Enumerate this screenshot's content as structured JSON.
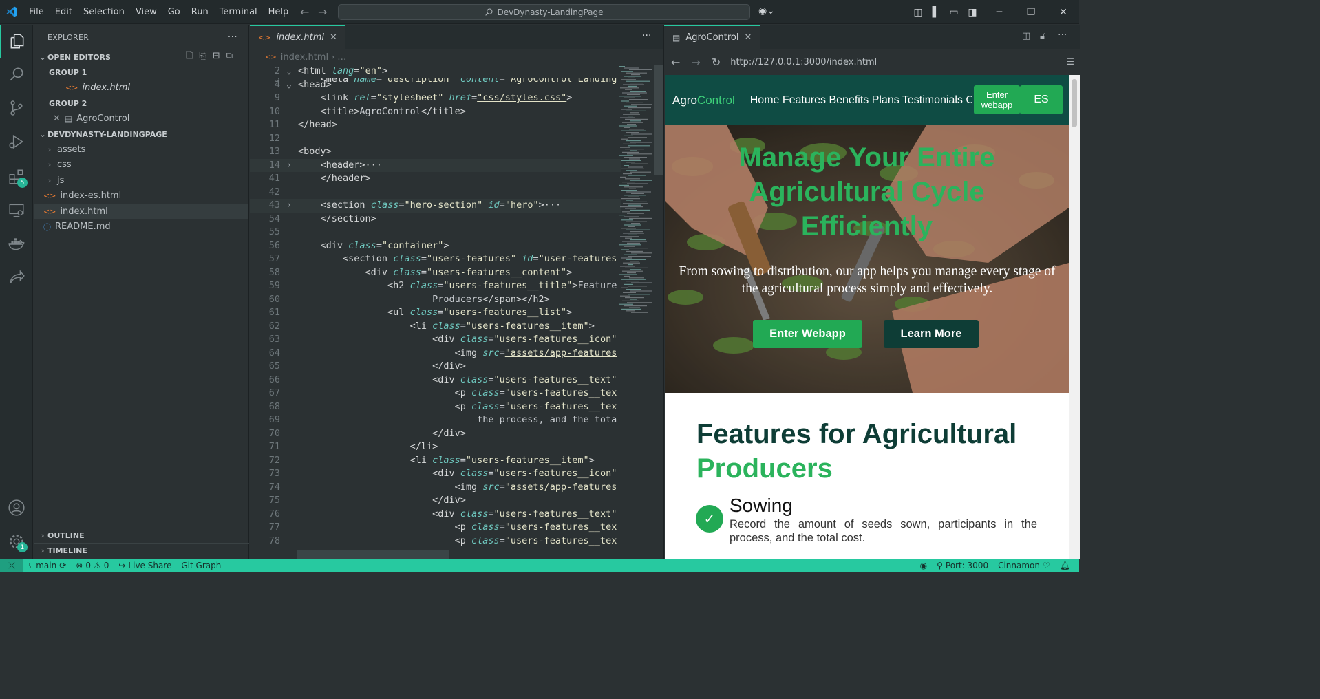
{
  "titlebar": {
    "menu": [
      "File",
      "Edit",
      "Selection",
      "View",
      "Go",
      "Run",
      "Terminal",
      "Help"
    ],
    "command_center": "DevDynasty-LandingPage"
  },
  "activity": {
    "extensions_badge": "5",
    "manage_badge": "1"
  },
  "sidebar": {
    "title": "EXPLORER",
    "open_editors_label": "OPEN EDITORS",
    "group1_label": "GROUP 1",
    "group1_file": "index.html",
    "group2_label": "GROUP 2",
    "group2_file": "AgroControl",
    "project_label": "DEVDYNASTY-LANDINGPAGE",
    "folders": [
      "assets",
      "css",
      "js"
    ],
    "files": [
      "index-es.html",
      "index.html",
      "README.md"
    ],
    "outline_label": "OUTLINE",
    "timeline_label": "TIMELINE"
  },
  "editor": {
    "tab_label": "index.html",
    "breadcrumb": "index.html",
    "breadcrumb_more": "…",
    "lines": [
      {
        "n": "2",
        "fold": "⌄",
        "html": "<span class=\"tg\">&lt;html</span> <span class=\"at\">lang</span><span class=\"pl\">=</span><span class=\"st\">\"en\"</span><span class=\"tg\">&gt;</span>"
      },
      {
        "n": "4",
        "fold": "⌄",
        "html": "<span class=\"tg\">&lt;head&gt;</span>"
      },
      {
        "n": "9",
        "fold": "",
        "html": "    <span class=\"tg\">&lt;link</span> <span class=\"at\">rel</span>=<span class=\"st\">\"stylesheet\"</span> <span class=\"at\">href</span>=<span class=\"st ul\">\"css/styles.css\"</span><span class=\"tg\">&gt;</span>"
      },
      {
        "n": "10",
        "fold": "",
        "html": "    <span class=\"tg\">&lt;title&gt;</span>AgroControl<span class=\"tg\">&lt;/title&gt;</span>"
      },
      {
        "n": "11",
        "fold": "",
        "html": "<span class=\"tg\">&lt;/head&gt;</span>"
      },
      {
        "n": "12",
        "fold": "",
        "html": ""
      },
      {
        "n": "13",
        "fold": "",
        "html": "<span class=\"tg\">&lt;body&gt;</span>"
      },
      {
        "n": "14",
        "fold": "›",
        "html": "    <span class=\"tg\">&lt;header&gt;</span><span class=\"pl\">···</span>"
      },
      {
        "n": "41",
        "fold": "",
        "html": "    <span class=\"tg\">&lt;/header&gt;</span>"
      },
      {
        "n": "42",
        "fold": "",
        "html": ""
      },
      {
        "n": "43",
        "fold": "›",
        "html": "    <span class=\"tg\">&lt;section</span> <span class=\"at\">class</span>=<span class=\"st\">\"hero-section\"</span> <span class=\"at\">id</span>=<span class=\"st\">\"hero\"</span><span class=\"tg\">&gt;</span><span class=\"pl\">···</span>"
      },
      {
        "n": "54",
        "fold": "",
        "html": "    <span class=\"tg\">&lt;/section&gt;</span>"
      },
      {
        "n": "55",
        "fold": "",
        "html": ""
      },
      {
        "n": "56",
        "fold": "",
        "html": "    <span class=\"tg\">&lt;div</span> <span class=\"at\">class</span>=<span class=\"st\">\"container\"</span><span class=\"tg\">&gt;</span>"
      },
      {
        "n": "57",
        "fold": "",
        "html": "        <span class=\"tg\">&lt;section</span> <span class=\"at\">class</span>=<span class=\"st\">\"users-features\"</span> <span class=\"at\">id</span>=<span class=\"st\">\"user-features</span>"
      },
      {
        "n": "58",
        "fold": "",
        "html": "            <span class=\"tg\">&lt;div</span> <span class=\"at\">class</span>=<span class=\"st\">\"users-features__content\"</span><span class=\"tg\">&gt;</span>"
      },
      {
        "n": "59",
        "fold": "",
        "html": "                <span class=\"tg\">&lt;h2</span> <span class=\"at\">class</span>=<span class=\"st\">\"users-features__title\"</span><span class=\"tg\">&gt;</span>Feature"
      },
      {
        "n": "60",
        "fold": "",
        "html": "                        Producers<span class=\"tg\">&lt;/span&gt;&lt;/h2&gt;</span>"
      },
      {
        "n": "61",
        "fold": "",
        "html": "                <span class=\"tg\">&lt;ul</span> <span class=\"at\">class</span>=<span class=\"st\">\"users-features__list\"</span><span class=\"tg\">&gt;</span>"
      },
      {
        "n": "62",
        "fold": "",
        "html": "                    <span class=\"tg\">&lt;li</span> <span class=\"at\">class</span>=<span class=\"st\">\"users-features__item\"</span><span class=\"tg\">&gt;</span>"
      },
      {
        "n": "63",
        "fold": "",
        "html": "                        <span class=\"tg\">&lt;div</span> <span class=\"at\">class</span>=<span class=\"st\">\"users-features__icon\"</span>"
      },
      {
        "n": "64",
        "fold": "",
        "html": "                            <span class=\"tg\">&lt;img</span> <span class=\"at\">src</span>=<span class=\"st ul\">\"assets/app-features</span>"
      },
      {
        "n": "65",
        "fold": "",
        "html": "                        <span class=\"tg\">&lt;/div&gt;</span>"
      },
      {
        "n": "66",
        "fold": "",
        "html": "                        <span class=\"tg\">&lt;div</span> <span class=\"at\">class</span>=<span class=\"st\">\"users-features__text\"</span>"
      },
      {
        "n": "67",
        "fold": "",
        "html": "                            <span class=\"tg\">&lt;p</span> <span class=\"at\">class</span>=<span class=\"st\">\"users-features__tex</span>"
      },
      {
        "n": "68",
        "fold": "",
        "html": "                            <span class=\"tg\">&lt;p</span> <span class=\"at\">class</span>=<span class=\"st\">\"users-features__tex</span>"
      },
      {
        "n": "69",
        "fold": "",
        "html": "                                the process, and the tota"
      },
      {
        "n": "70",
        "fold": "",
        "html": "                        <span class=\"tg\">&lt;/div&gt;</span>"
      },
      {
        "n": "71",
        "fold": "",
        "html": "                    <span class=\"tg\">&lt;/li&gt;</span>"
      },
      {
        "n": "72",
        "fold": "",
        "html": "                    <span class=\"tg\">&lt;li</span> <span class=\"at\">class</span>=<span class=\"st\">\"users-features__item\"</span><span class=\"tg\">&gt;</span>"
      },
      {
        "n": "73",
        "fold": "",
        "html": "                        <span class=\"tg\">&lt;div</span> <span class=\"at\">class</span>=<span class=\"st\">\"users-features__icon\"</span>"
      },
      {
        "n": "74",
        "fold": "",
        "html": "                            <span class=\"tg\">&lt;img</span> <span class=\"at\">src</span>=<span class=\"st ul\">\"assets/app-features</span>"
      },
      {
        "n": "75",
        "fold": "",
        "html": "                        <span class=\"tg\">&lt;/div&gt;</span>"
      },
      {
        "n": "76",
        "fold": "",
        "html": "                        <span class=\"tg\">&lt;div</span> <span class=\"at\">class</span>=<span class=\"st\">\"users-features__text\"</span>"
      },
      {
        "n": "77",
        "fold": "",
        "html": "                            <span class=\"tg\">&lt;p</span> <span class=\"at\">class</span>=<span class=\"st\">\"users-features__tex</span>"
      },
      {
        "n": "78",
        "fold": "",
        "html": "                            <span class=\"tg\">&lt;p</span> <span class=\"at\">class</span>=<span class=\"st\">\"users-features__tex</span>"
      }
    ],
    "sticky_line": {
      "n": "5",
      "html": "    <span class=\"tg\">&lt;meta</span> <span class=\"at\">name</span>=<span class=\"st\">\"description\"</span> <span class=\"at\">content</span>=<span class=\"st\">\"AgroControl Landing</span>"
    }
  },
  "preview": {
    "tab_label": "AgroControl",
    "url": "http://127.0.0.1:3000/index.html",
    "site": {
      "logo_a": "Agro",
      "logo_b": "Control",
      "nav": "Home Features Benefits Plans Testimonials Co",
      "enter_webapp_small": "Enter webapp",
      "lang_button": "ES",
      "hero_title": "Manage Your Entire Agricultural Cycle Efficiently",
      "hero_subtitle": "From sowing to distribution, our app helps you manage every stage of the agricultural process simply and effectively.",
      "btn_enter": "Enter Webapp",
      "btn_learn": "Learn More",
      "features_title_a": "Features for Agricultural",
      "features_title_b": "Producers",
      "feature1_title": "Sowing",
      "feature1_text": "Record the amount of seeds sown, participants in the process, and the total cost."
    }
  },
  "statusbar": {
    "branch": "main",
    "errors": "0",
    "warnings": "0",
    "live_share": "Live Share",
    "git_graph": "Git Graph",
    "port": "Port: 3000",
    "theme": "Cinnamon"
  },
  "colors": {
    "accent": "#27c9a0",
    "site_header": "#0f4c44",
    "site_green": "#22a954",
    "site_dark": "#0e3d36"
  }
}
